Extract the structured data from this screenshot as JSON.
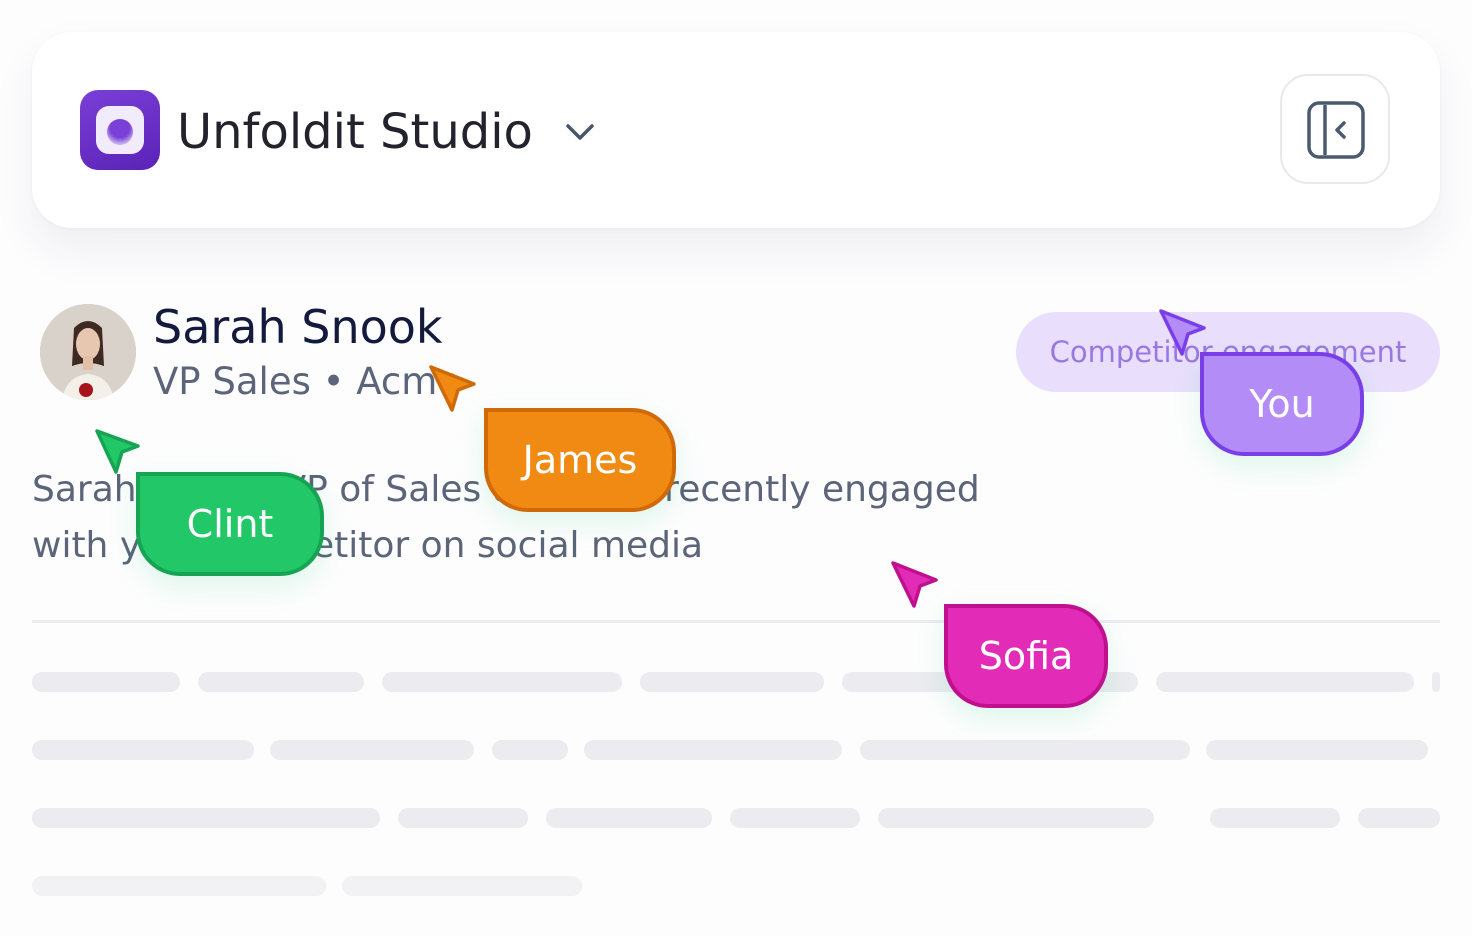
{
  "header": {
    "workspace_name": "Unfoldit Studio",
    "logo_icon": "unfoldit-logo",
    "dropdown_icon": "chevron-down-icon",
    "collapse_icon": "sidebar-collapse-icon"
  },
  "contact": {
    "name": "Sarah Snook",
    "subtitle": "VP Sales • Acme",
    "tag": "Competitor engagement",
    "description": "Sarah Snook, VP of Sales at Acme, recently engaged with your competitor on social media"
  },
  "cursors": [
    {
      "name": "Clint",
      "color": "#22c768",
      "border": "#16a352"
    },
    {
      "name": "James",
      "color": "#f08a12",
      "border": "#d06a08"
    },
    {
      "name": "You",
      "color": "#b48cf7",
      "border": "#7a3ee8"
    },
    {
      "name": "Sofia",
      "color": "#e22bb6",
      "border": "#c0108f"
    }
  ],
  "colors": {
    "accent": "#6a30c8",
    "tag_bg": "#e9dffd",
    "tag_text": "#9a78e2",
    "skeleton": "#ebebf0"
  }
}
